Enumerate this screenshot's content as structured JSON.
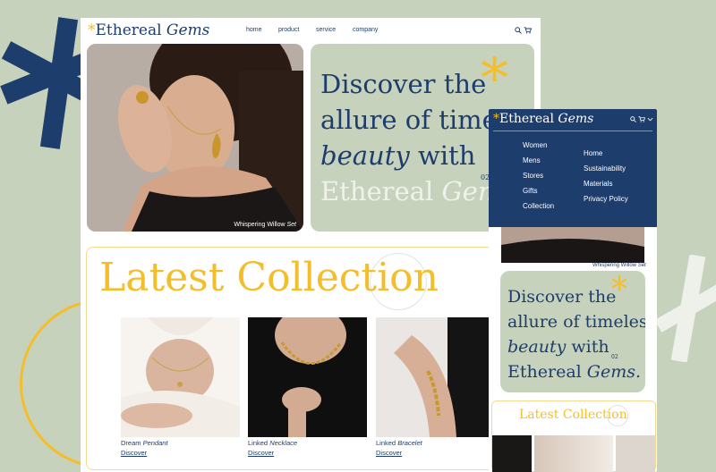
{
  "desktop": {
    "logo_star": "*",
    "logo_word": "Ethereal",
    "logo_italic": "Gems",
    "nav": [
      "home",
      "product",
      "service",
      "company"
    ],
    "icons": [
      "search-icon",
      "cart-icon"
    ],
    "hero": {
      "caption_plain": "Whispering Willow ",
      "caption_italic": "Set",
      "line1": "Discover the",
      "line2": "allure of timeless",
      "line3_italic": "beauty",
      "line3_plain": " with",
      "line4_plain": "Ethereal ",
      "line4_italic": "Gems.",
      "number": "02",
      "star": "*"
    },
    "latest_title": "Latest Collection",
    "products": [
      {
        "name_plain": "Dream ",
        "name_italic": "Pendant",
        "link": "Discover"
      },
      {
        "name_plain": "Linked ",
        "name_italic": "Necklace",
        "link": "Discover"
      },
      {
        "name_plain": "Linked ",
        "name_italic": "Bracelet",
        "link": "Discover"
      }
    ]
  },
  "mobile": {
    "logo_star": "*",
    "logo_word": "Ethereal",
    "logo_italic": "Gems",
    "icons": [
      "search-icon",
      "cart-icon",
      "chevron-down-icon"
    ],
    "menu_left": [
      "Women",
      "Mens",
      "Stores",
      "Gifts",
      "Collection"
    ],
    "menu_right": [
      "Home",
      "Sustainability",
      "Materials",
      "Privacy Policy"
    ],
    "image_caption_plain": "Whispering Willow ",
    "image_caption_italic": "Set",
    "hero": {
      "line1": "Discover the",
      "line2": "allure of timeless",
      "line3_italic": "beauty",
      "line3_plain": " with",
      "line4_plain": "Ethereal ",
      "line4_italic": "Gems.",
      "number": "02",
      "star": "*"
    },
    "latest_title": "Latest Collection"
  },
  "colors": {
    "navy": "#1d3d6d",
    "sage": "#c7d2bd",
    "gold": "#f4be2b"
  }
}
